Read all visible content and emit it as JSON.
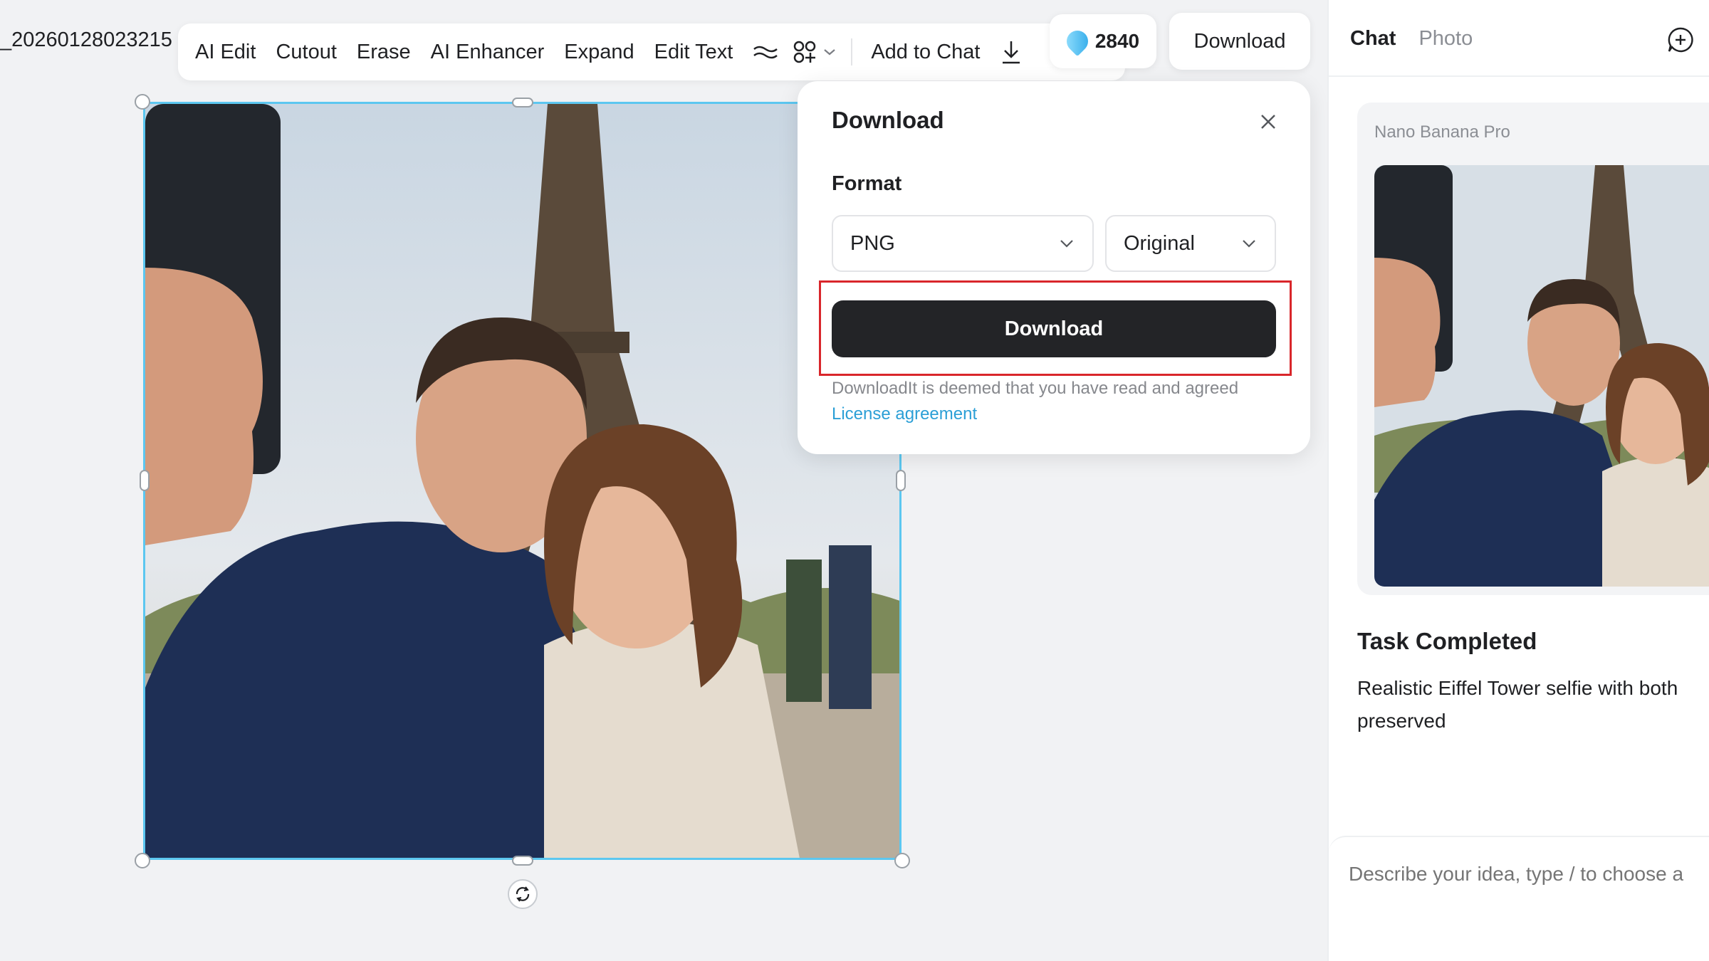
{
  "file": {
    "name": "_20260128023215"
  },
  "toolbar": {
    "items": [
      "AI Edit",
      "Cutout",
      "Erase",
      "AI Enhancer",
      "Expand",
      "Edit Text"
    ],
    "add_to_chat": "Add to Chat"
  },
  "credits": {
    "count": "2840"
  },
  "header": {
    "download_label": "Download"
  },
  "download_popup": {
    "title": "Download",
    "format_label": "Format",
    "format_value": "PNG",
    "size_value": "Original",
    "button_label": "Download",
    "agreement_text": "DownloadIt is deemed that you have read and agreed",
    "license_link": "License agreement"
  },
  "panel": {
    "tab_chat": "Chat",
    "tab_photo": "Photo",
    "model_name": "Nano Banana Pro",
    "task_title": "Task Completed",
    "task_desc": "Realistic Eiffel Tower selfie with both preserved",
    "input_placeholder": "Describe your idea, type / to choose a"
  },
  "colors": {
    "accent": "#2b9fd6",
    "selection": "#5cc7f0",
    "highlight": "#d9262b",
    "button_dark": "#232427"
  }
}
